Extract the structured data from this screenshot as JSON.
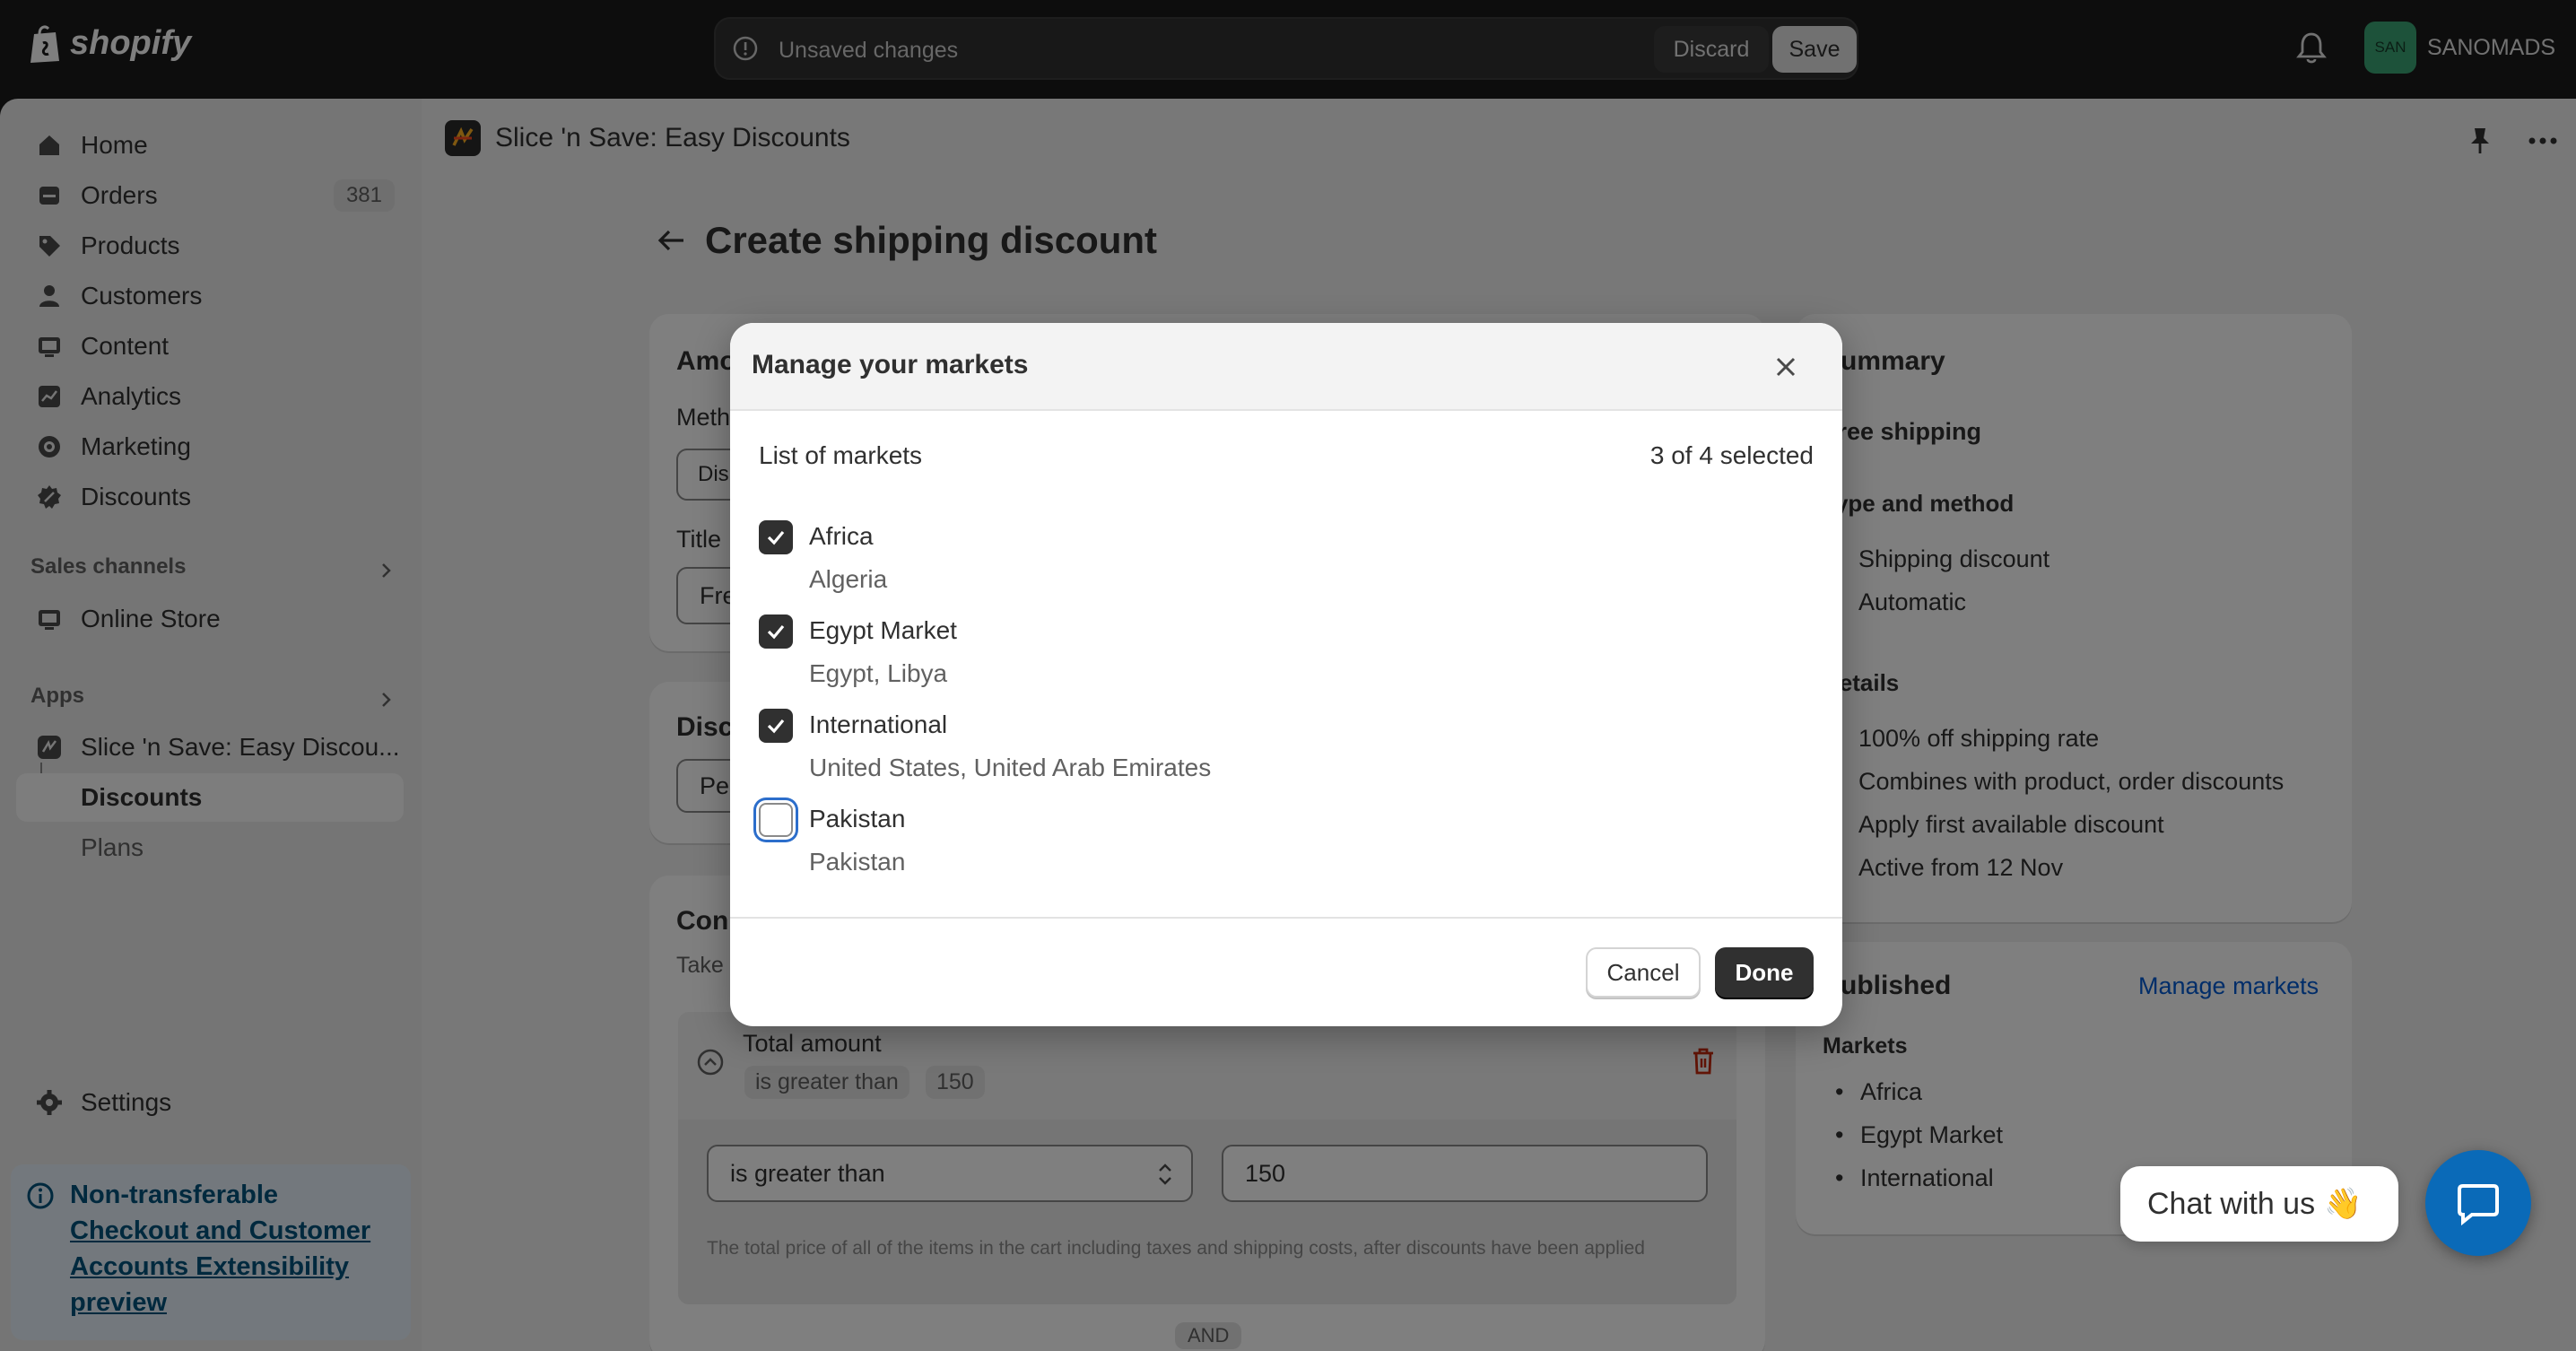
{
  "topbar": {
    "logo_text": "shopify",
    "unsaved_text": "Unsaved changes",
    "discard_label": "Discard",
    "save_label": "Save",
    "store_initials": "SAN",
    "store_name": "SANOMADS"
  },
  "sidebar": {
    "items": [
      {
        "label": "Home",
        "icon": "home-icon"
      },
      {
        "label": "Orders",
        "icon": "orders-icon",
        "badge": "381"
      },
      {
        "label": "Products",
        "icon": "tag-icon"
      },
      {
        "label": "Customers",
        "icon": "person-icon"
      },
      {
        "label": "Content",
        "icon": "content-icon"
      },
      {
        "label": "Analytics",
        "icon": "chart-icon"
      },
      {
        "label": "Marketing",
        "icon": "target-icon"
      },
      {
        "label": "Discounts",
        "icon": "discount-icon"
      }
    ],
    "sales_channels_label": "Sales channels",
    "online_store_label": "Online Store",
    "apps_label": "Apps",
    "app_name": "Slice 'n Save: Easy Discou...",
    "app_sub_discounts": "Discounts",
    "app_sub_plans": "Plans",
    "settings_label": "Settings",
    "notice_title": "Non-transferable",
    "notice_link": "Checkout and Customer Accounts Extensibility",
    "notice_tail": "preview"
  },
  "main": {
    "app_title": "Slice 'n Save: Easy Discounts",
    "page_title": "Create shipping discount",
    "amount_card": {
      "heading_partial": "Amo",
      "method_partial": "Meth",
      "method_btn_partial": "Dis",
      "title_partial": "Title",
      "title_value_partial": "Fre"
    },
    "discount_card": {
      "heading_partial": "Disc",
      "select_partial": "Per"
    },
    "conditions_card": {
      "heading_partial": "Con",
      "subtext_partial": "Take",
      "condition_title": "Total amount",
      "pill_operator": "is greater than",
      "pill_value": "150",
      "select_value": "is greater than",
      "input_value": "150",
      "help_text": "The total price of all of the items in the cart including taxes and shipping costs, after discounts have been applied",
      "and_label": "AND"
    },
    "summary": {
      "heading": "Summary",
      "offer": "Free shipping",
      "type_heading": "Type and method",
      "type_items": [
        "Shipping discount",
        "Automatic"
      ],
      "details_heading": "Details",
      "details_items": [
        "100% off shipping rate",
        "Combines with product, order discounts",
        "Apply first available discount",
        "Active from 12 Nov"
      ]
    },
    "published": {
      "heading": "Published",
      "manage_link": "Manage markets",
      "markets_label": "Markets",
      "markets": [
        "Africa",
        "Egypt Market",
        "International"
      ]
    }
  },
  "modal": {
    "title": "Manage your markets",
    "list_label": "List of markets",
    "selected_count": "3 of 4 selected",
    "markets": [
      {
        "name": "Africa",
        "countries": "Algeria",
        "checked": true
      },
      {
        "name": "Egypt Market",
        "countries": "Egypt, Libya",
        "checked": true
      },
      {
        "name": "International",
        "countries": "United States, United Arab Emirates",
        "checked": true
      },
      {
        "name": "Pakistan",
        "countries": "Pakistan",
        "checked": false
      }
    ],
    "cancel_label": "Cancel",
    "done_label": "Done"
  },
  "chat": {
    "label": "Chat with us",
    "emoji": "👋"
  },
  "colors": {
    "accent": "#303030",
    "link": "#005bd3",
    "chat": "#0a6ab8",
    "focus": "#2c6ecb"
  }
}
